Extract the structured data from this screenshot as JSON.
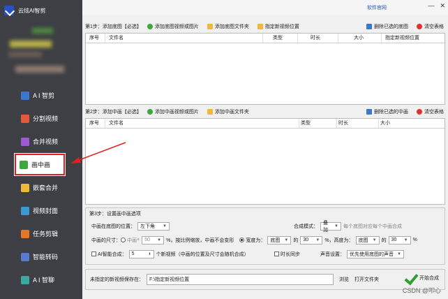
{
  "app": {
    "name": "云炫AI智剪",
    "official_site": "软件官网"
  },
  "sidebar": {
    "items": [
      {
        "label": "A I 智剪",
        "icon": "scissors-icon",
        "color": "#3a78d0"
      },
      {
        "label": "分割视频",
        "icon": "split-icon",
        "color": "#e05a3a"
      },
      {
        "label": "合并视频",
        "icon": "merge-icon",
        "color": "#a05ad0"
      },
      {
        "label": "画中画",
        "icon": "picture-in-picture-icon",
        "color": "#3aa83a",
        "active": true
      },
      {
        "label": "嵌套合并",
        "icon": "nest-icon",
        "color": "#f0b93a"
      },
      {
        "label": "视频封面",
        "icon": "cover-icon",
        "color": "#3a9ad0"
      },
      {
        "label": "任务剪辑",
        "icon": "task-icon",
        "color": "#e07a2a"
      },
      {
        "label": "智能转码",
        "icon": "transcode-icon",
        "color": "#5a7ad0"
      },
      {
        "label": "A I 智聊",
        "icon": "chat-icon",
        "color": "#3aa8a0"
      }
    ]
  },
  "step1": {
    "label": "第1步：添加底图【必选】",
    "add_files": "添加底图视频或图片",
    "add_folder": "添加底图文件夹",
    "set_location": "指定新视频位置",
    "delete_selected": "删除已选的底图",
    "clear": "清空表格",
    "columns": [
      "序号",
      "文件名",
      "类型",
      "时长",
      "大小",
      "指定新视频位置"
    ]
  },
  "step2": {
    "label": "第2步：添加中画【必选】",
    "add_files": "添加中画视频或图片",
    "add_folder": "添加中画文件夹",
    "delete_selected": "删除已选的中画",
    "clear": "清空表格",
    "columns": [
      "序号",
      "文件名",
      "类型",
      "时长",
      "大小"
    ]
  },
  "step3": {
    "title": "第3步：设置画中画选项",
    "position_label": "中画在底图的位置：",
    "position_value": "左下角",
    "mode_label": "合成模式：",
    "mode_value": "叠加",
    "mode_hint": "每个底图对应每个中画合成",
    "size_label": "中画的尺寸：",
    "size_option_medium": "中画",
    "size_x": "×",
    "size_pct_value": "50",
    "size_pct_suffix": "%，按比例缩放，中画不会变形",
    "width_option": "宽度为：",
    "width_ref": "底图",
    "of": "的",
    "width_pct": "30",
    "height_label": "%，高度为：",
    "height_ref": "底图",
    "height_pct": "30",
    "pct": "%",
    "ai_compose": "AI智能合成：",
    "ai_count": "5",
    "ai_hint": "个新视频（中画的位置及尺寸会随机合成）",
    "sync": "时长同步",
    "audio_label": "声音设置：",
    "audio_value": "优先使用底图的声音"
  },
  "save": {
    "label": "未指定的新视频保存在：",
    "path": "F:\\指定新视频位置",
    "browse": "浏览",
    "open_folder": "打开文件夹",
    "start": "开始合成"
  },
  "watermark": "CSDN @叩心"
}
